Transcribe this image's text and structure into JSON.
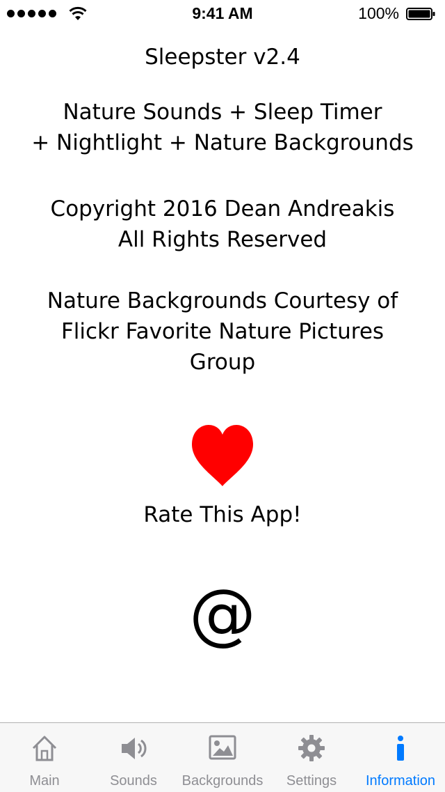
{
  "status_bar": {
    "time": "9:41 AM",
    "battery_percent": "100%"
  },
  "content": {
    "title": "Sleepster v2.4",
    "tagline_line1": "Nature Sounds + Sleep Timer",
    "tagline_line2": "+ Nightlight + Nature Backgrounds",
    "copyright_line1": "Copyright 2016 Dean Andreakis",
    "copyright_line2": "All Rights Reserved",
    "credit_line1": "Nature Backgrounds Courtesy of",
    "credit_line2": "Flickr Favorite Nature Pictures",
    "credit_line3": "Group",
    "rate_label": "Rate This App!",
    "contact_symbol": "@"
  },
  "colors": {
    "heart": "#ff0000",
    "tab_active": "#007aff",
    "tab_inactive": "#8e8e93"
  },
  "tabs": [
    {
      "label": "Main",
      "icon": "home-icon"
    },
    {
      "label": "Sounds",
      "icon": "speaker-icon"
    },
    {
      "label": "Backgrounds",
      "icon": "picture-icon"
    },
    {
      "label": "Settings",
      "icon": "gear-icon"
    },
    {
      "label": "Information",
      "icon": "info-icon",
      "active": true
    }
  ]
}
